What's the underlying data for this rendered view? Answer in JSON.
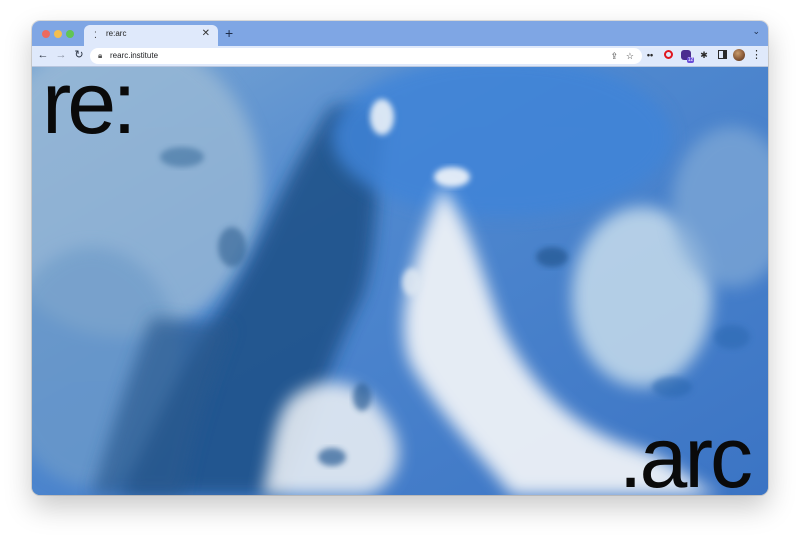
{
  "browser": {
    "tab": {
      "title": "re:arc"
    },
    "new_tab_symbol": "+",
    "url": "rearc.institute",
    "extension_badge": "12"
  },
  "page": {
    "logo_top": "re:",
    "logo_bottom": ".arc",
    "colors": {
      "water_blue": "#4f88cf",
      "deep_blue": "#1f4f86",
      "foam_white": "#e8eef5",
      "text": "#0a0a0a"
    }
  }
}
